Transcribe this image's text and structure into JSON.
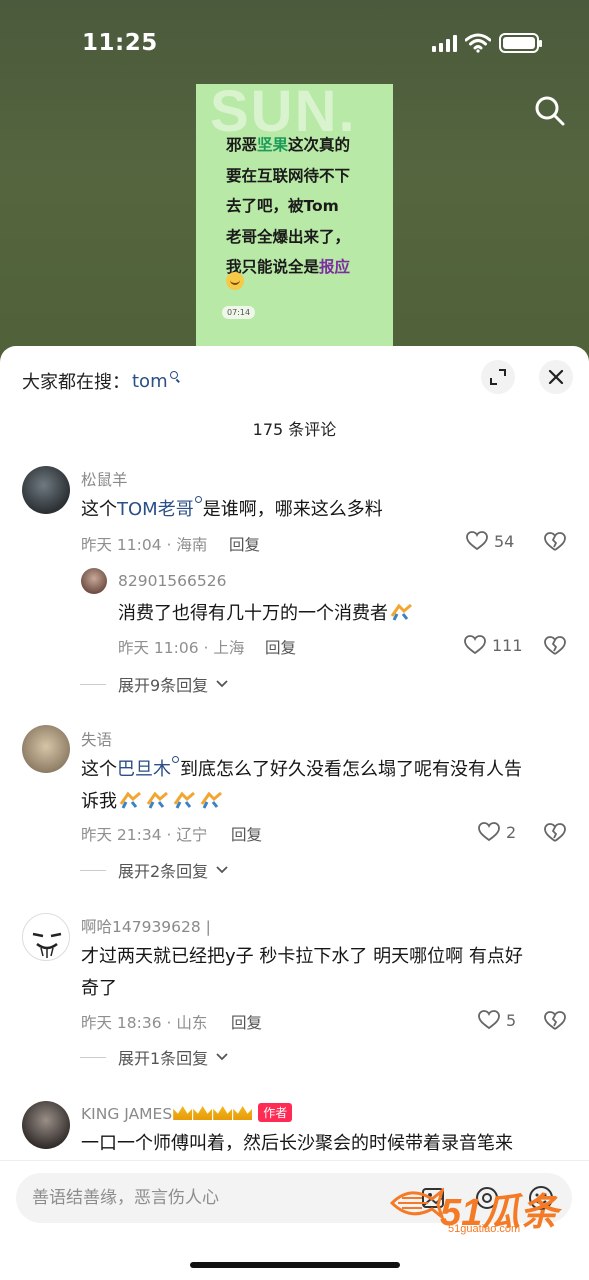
{
  "status": {
    "time": "11:25"
  },
  "video": {
    "watermark_text": "SUN.",
    "lines": [
      {
        "a": "邪恶",
        "hl": "坚果",
        "b": "这次真的"
      },
      {
        "a": "要在互联网待不下",
        "hl": "",
        "b": ""
      },
      {
        "a": "去了吧，被Tom",
        "hl": "",
        "b": ""
      },
      {
        "a": "老哥全爆出来了，",
        "hl": "",
        "b": ""
      },
      {
        "a": "我只能说全是",
        "hl2": "报应",
        "b": ""
      }
    ],
    "time_badge": "07:14"
  },
  "sheet": {
    "hot_search_label": "大家都在搜：",
    "hot_search_keyword": "tom",
    "comment_count": "175 条评论"
  },
  "comments": [
    {
      "user": "松鼠羊",
      "text_before": "这个",
      "tag": "TOM老哥",
      "text_after": "是谁啊，哪来这么多料",
      "meta": "昨天 11:04 · 海南",
      "reply_label": "回复",
      "likes": "54"
    },
    {
      "user": "82901566526",
      "text": "消费了也得有几十万的一个消费者",
      "meta": "昨天 11:06 · 上海",
      "reply_label": "回复",
      "likes": "111",
      "expand": "展开9条回复"
    },
    {
      "user": "失语",
      "text_before": "这个",
      "tag": "巴旦木",
      "text_after": "到底怎么了好久没看怎么塌了呢有没有人告",
      "text_line2": "诉我",
      "meta": "昨天 21:34 · 辽宁",
      "reply_label": "回复",
      "likes": "2",
      "expand": "展开2条回复"
    },
    {
      "user": "啊哈147939628 |",
      "text_line1": "才过两天就已经把y子 秒卡拉下水了 明天哪位啊 有点好",
      "text_line2": "奇了",
      "meta": "昨天 18:36 · 山东",
      "reply_label": "回复",
      "likes": "5",
      "expand": "展开1条回复"
    },
    {
      "user": "KING JAMES",
      "badge": "作者",
      "text": "一口一个师傅叫着，然后长沙聚会的时候带着录音笔来"
    }
  ],
  "input": {
    "placeholder": "善语结善缘，恶言伤人心"
  },
  "watermark": {
    "big": "51瓜条",
    "small": "51guatiao.com"
  },
  "colors": {
    "accent_link": "#2b4f86",
    "author_badge": "#fe2c55",
    "video_bg": "#b9e9a6"
  }
}
